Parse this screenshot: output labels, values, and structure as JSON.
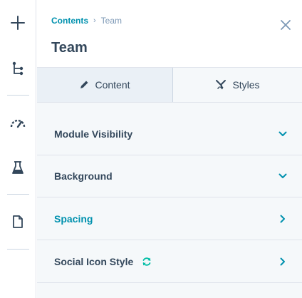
{
  "rail": {
    "buttons": [
      "add-icon",
      "tree-icon",
      "gauge-icon",
      "flask-icon",
      "page-icon"
    ]
  },
  "header": {
    "breadcrumb_parent": "Contents",
    "breadcrumb_separator": "›",
    "breadcrumb_current": "Team",
    "title": "Team"
  },
  "tabs": [
    {
      "label": "Content",
      "icon": "pencil-icon"
    },
    {
      "label": "Styles",
      "icon": "brush-icon"
    }
  ],
  "sections": [
    {
      "label": "Module Visibility",
      "chevron": "down"
    },
    {
      "label": "Background",
      "chevron": "down"
    },
    {
      "label": "Spacing",
      "chevron": "right"
    },
    {
      "label": "Social Icon Style",
      "chevron": "right",
      "badge": "sync-icon"
    }
  ],
  "colors": {
    "accent": "#0091ae",
    "text": "#33475b",
    "muted": "#7c98b6",
    "panel_bg": "#f5f8fa",
    "border": "#dfe3eb"
  }
}
